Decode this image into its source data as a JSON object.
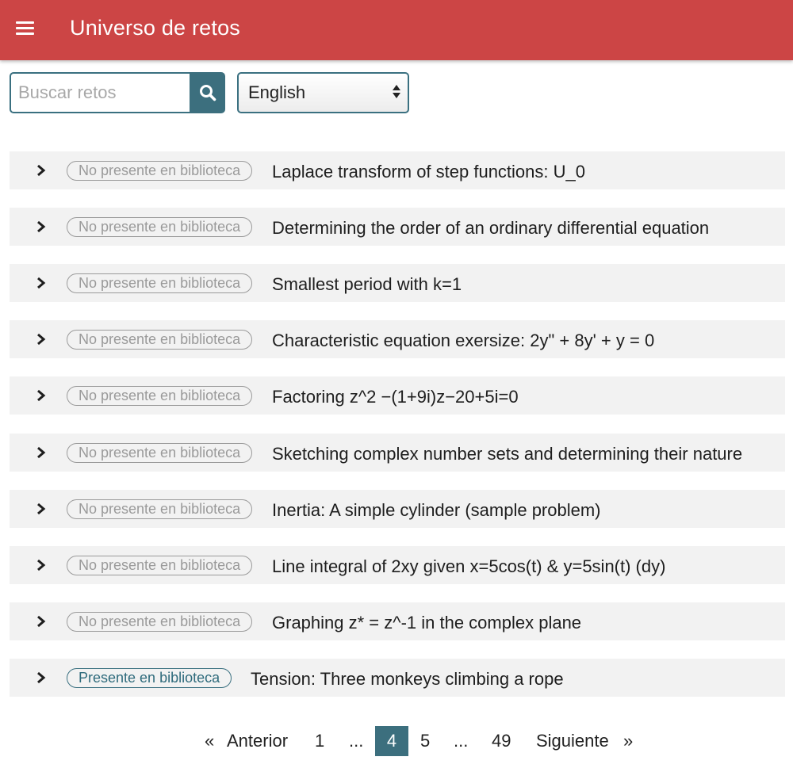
{
  "header": {
    "menu_icon": "hamburger-menu-icon",
    "title": "Universo de retos",
    "bg_color": "#cc4545"
  },
  "search": {
    "placeholder": "Buscar retos",
    "value": "",
    "button_icon": "search-icon"
  },
  "language": {
    "selected": "English"
  },
  "colors": {
    "accent": "#3c6f7e",
    "row_bg": "#f2f2f2",
    "badge_absent": "#9a9a9a"
  },
  "challenges": [
    {
      "status": "No presente en biblioteca",
      "present": false,
      "title": "Laplace transform of step functions: U_0"
    },
    {
      "status": "No presente en biblioteca",
      "present": false,
      "title": "Determining the order of an ordinary differential equation"
    },
    {
      "status": "No presente en biblioteca",
      "present": false,
      "title": "Smallest period with k=1"
    },
    {
      "status": "No presente en biblioteca",
      "present": false,
      "title": "Characteristic equation exersize: 2y\" + 8y' + y = 0"
    },
    {
      "status": "No presente en biblioteca",
      "present": false,
      "title": "Factoring z^2 −(1+9i)z−20+5i=0"
    },
    {
      "status": "No presente en biblioteca",
      "present": false,
      "title": "Sketching complex number sets and determining their nature"
    },
    {
      "status": "No presente en biblioteca",
      "present": false,
      "title": "Inertia: A simple cylinder (sample problem)"
    },
    {
      "status": "No presente en biblioteca",
      "present": false,
      "title": "Line integral of 2xy given x=5cos(t) & y=5sin(t) (dy)"
    },
    {
      "status": "No presente en biblioteca",
      "present": false,
      "title": "Graphing z* = z^-1 in the complex plane"
    },
    {
      "status": "Presente en biblioteca",
      "present": true,
      "title": "Tension: Three monkeys climbing a rope"
    }
  ],
  "pagination": {
    "first_arrow": "«",
    "prev_label": "Anterior",
    "pages": [
      "1",
      "...",
      "4",
      "5",
      "...",
      "49"
    ],
    "current_page": "4",
    "next_label": "Siguiente",
    "last_arrow": "»"
  }
}
